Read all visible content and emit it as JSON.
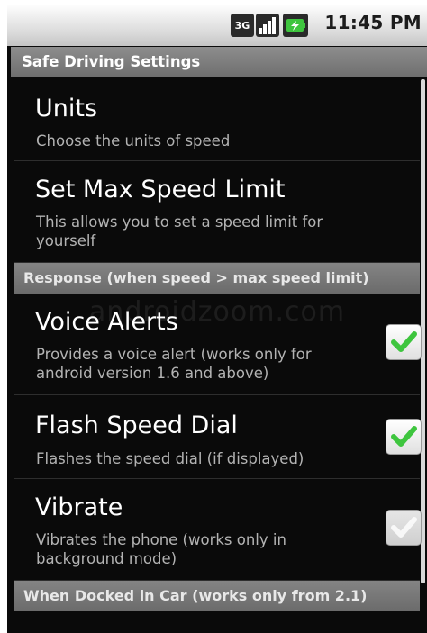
{
  "status_bar": {
    "time": "11:45 PM",
    "network_badge": "3G"
  },
  "app_title": "Safe Driving Settings",
  "preferences": [
    {
      "title": "Units",
      "summary": [
        "Choose the units of speed"
      ]
    },
    {
      "title": "Set Max Speed Limit",
      "summary": [
        "This allows you to set a speed limit for",
        "yourself"
      ]
    }
  ],
  "section_response": "Response (when speed > max speed limit)",
  "toggles": [
    {
      "title": "Voice Alerts",
      "summary": [
        "Provides a voice alert (works only for",
        "android version 1.6 and above)"
      ],
      "checked": true
    },
    {
      "title": "Flash Speed Dial",
      "summary": [
        "Flashes the speed dial (if displayed)"
      ],
      "checked": true
    },
    {
      "title": "Vibrate",
      "summary": [
        "Vibrates the phone (works only in",
        "background mode)"
      ],
      "checked": false
    }
  ],
  "section_docked": "When Docked in Car (works only from 2.1)",
  "watermark": "androidzoom.com",
  "colors": {
    "check_green": "#3ec53e",
    "header_gray": "#787878",
    "background": "#0a0a0a"
  },
  "icons": [
    "3g-icon",
    "signal-icon",
    "battery-icon",
    "checkmark-icon"
  ]
}
